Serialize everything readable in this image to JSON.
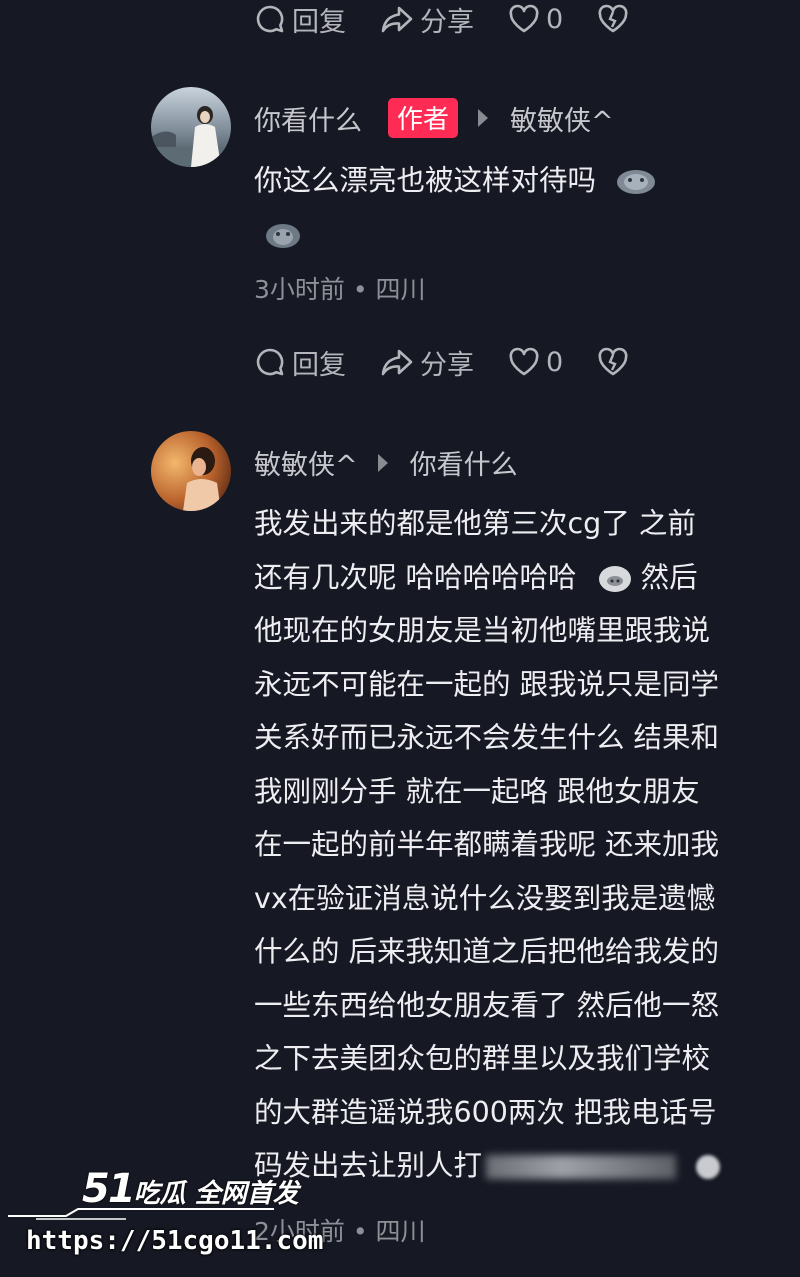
{
  "top_actions": {
    "reply_label": "回复",
    "share_label": "分享",
    "like_count": "0"
  },
  "comment1": {
    "username": "你看什么",
    "author_tag": "作者",
    "reply_to": "敏敏侠^",
    "text": "你这么漂亮也被这样对待吗",
    "time_location": "3小时前 • 四川",
    "actions": {
      "reply_label": "回复",
      "share_label": "分享",
      "like_count": "0"
    }
  },
  "comment2": {
    "username": "敏敏侠^",
    "reply_to": "你看什么",
    "lines": [
      "我发出来的都是他第三次cg了 之前",
      "还有几次呢 哈哈哈哈哈哈",
      "他现在的女朋友是当初他嘴里跟我说",
      "永远不可能在一起的 跟我说只是同学",
      "关系好而已永远不会发生什么 结果和",
      "我刚刚分手 就在一起咯 跟他女朋友",
      "在一起的前半年都瞒着我呢 还来加我",
      "vx在验证消息说什么没娶到我是遗憾",
      "什么的 后来我知道之后把他给我发的",
      "一些东西给他女朋友看了 然后他一怒",
      "之下去美团众包的群里以及我们学校",
      "的大群造谣说我600两次 把我电话号",
      "码发出去让别人打"
    ],
    "line2_suffix": "然后",
    "time_location": "2小时前 • 四川"
  },
  "watermark": {
    "logo_num": "51",
    "logo_text": "吃瓜 全网首发",
    "url": "https://51cgo11.com"
  }
}
